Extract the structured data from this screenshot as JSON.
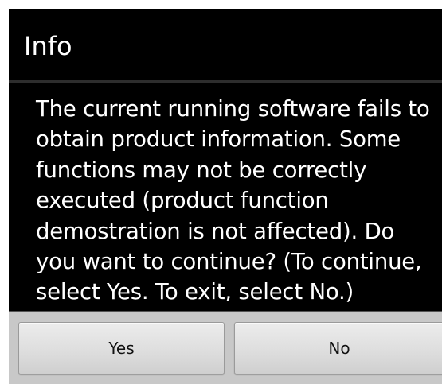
{
  "dialog": {
    "title": "Info",
    "message_lines": [
      "The current running software fails to",
      "obtain product information. Some",
      "functions may not be correctly",
      "executed (product function",
      "demostration is not affected). Do",
      "you want to continue? (To continue,",
      "select Yes. To exit, select No.)"
    ],
    "buttons": {
      "yes_label": "Yes",
      "no_label": "No"
    }
  },
  "colors": {
    "dialog_background": "#000000",
    "text": "#ffffff",
    "button_bar": "#c8c8c8",
    "button_face": "#dedede"
  }
}
